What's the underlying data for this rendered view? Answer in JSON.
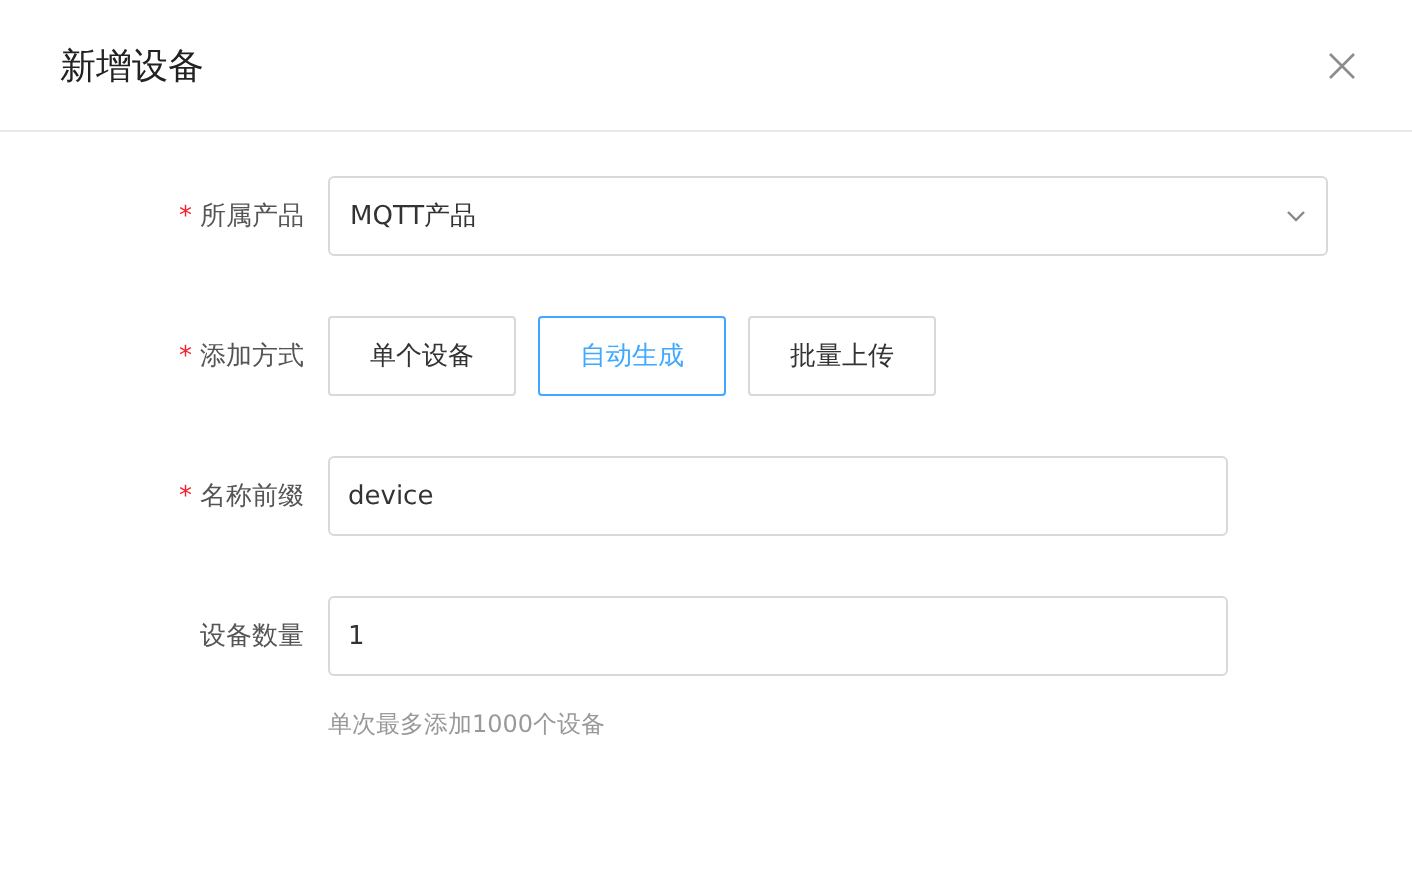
{
  "dialog": {
    "title": "新增设备"
  },
  "fields": [
    {
      "kind": "select",
      "required_mark": "*",
      "label": "所属产品",
      "value": "MQTT产品"
    },
    {
      "kind": "options",
      "required_mark": "*",
      "label": "添加方式",
      "options": [
        {
          "label": "单个设备",
          "selected": false
        },
        {
          "label": "自动生成",
          "selected": true
        },
        {
          "label": "批量上传",
          "selected": false
        }
      ]
    },
    {
      "kind": "input",
      "required_mark": "*",
      "label": "名称前缀",
      "value": "device"
    },
    {
      "kind": "input",
      "label": "设备数量",
      "value": "1",
      "hint": "单次最多添加1000个设备"
    }
  ]
}
